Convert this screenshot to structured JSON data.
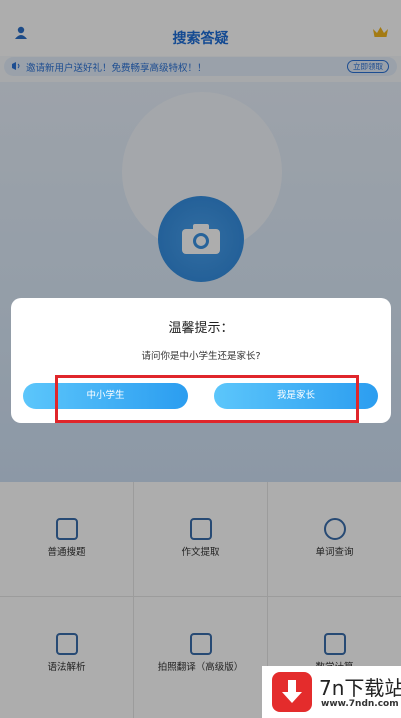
{
  "header": {
    "title": "搜索答疑"
  },
  "banner": {
    "text": "邀请新用户送好礼！免费畅享高级特权！！",
    "button_label": "立即领取"
  },
  "grid": {
    "items": [
      {
        "label": "普通搜题",
        "icon": "keyboard-icon"
      },
      {
        "label": "作文提取",
        "icon": "book-icon"
      },
      {
        "label": "单词查询",
        "icon": "magnifier-icon"
      },
      {
        "label": "语法解析",
        "icon": "grammar-icon"
      },
      {
        "label": "拍照翻译（高级版）",
        "icon": "translate-icon"
      },
      {
        "label": "数学计算",
        "icon": "calculator-icon"
      }
    ]
  },
  "dialog": {
    "title": "温馨提示：",
    "message": "请问你是中小学生还是家长?",
    "options": [
      {
        "label": "中小学生"
      },
      {
        "label": "我是家长"
      }
    ]
  },
  "watermark": {
    "main_text": "7n下载站",
    "url_text": "www.7ndn.com"
  },
  "colors": {
    "accent": "#2b9df0",
    "highlight_border": "#e0262b",
    "header_title": "#1e6ed8"
  }
}
